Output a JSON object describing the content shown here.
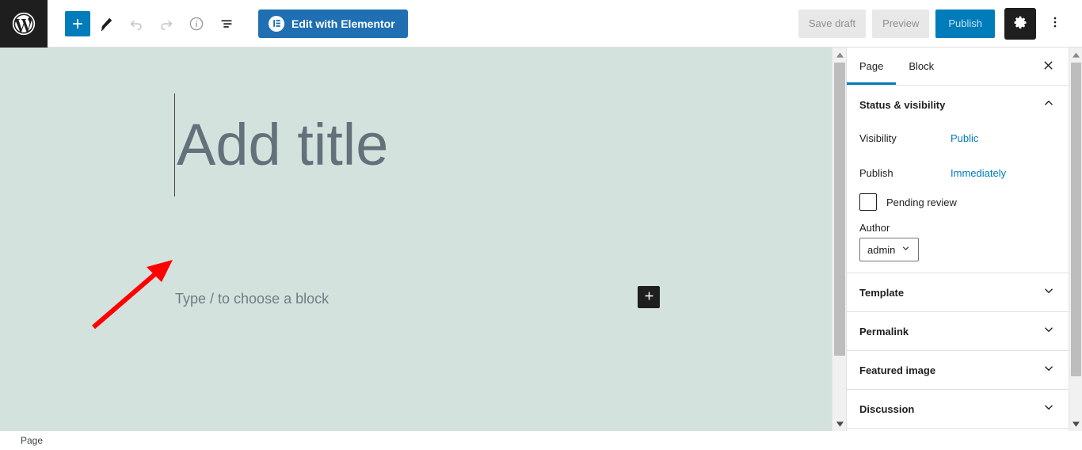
{
  "toolbar": {
    "logo_icon": "wordpress-logo-icon",
    "left_tools": [
      {
        "name": "add-block-button",
        "icon": "plus-icon",
        "label": "Add block",
        "state": "primary"
      },
      {
        "name": "tools-button",
        "icon": "pencil-icon",
        "label": "Tools",
        "state": "normal"
      },
      {
        "name": "undo-button",
        "icon": "undo-arrow-icon",
        "label": "Undo",
        "state": "disabled"
      },
      {
        "name": "redo-button",
        "icon": "redo-arrow-icon",
        "label": "Redo",
        "state": "disabled"
      },
      {
        "name": "details-button",
        "icon": "info-circle-icon",
        "label": "Details",
        "state": "normal"
      },
      {
        "name": "list-view-button",
        "icon": "list-view-icon",
        "label": "List view",
        "state": "normal"
      }
    ],
    "elementor_button": {
      "label": "Edit with Elementor",
      "icon": "elementor-logo-icon",
      "background": "#1f6fb2"
    },
    "save_draft_label": "Save draft",
    "preview_label": "Preview",
    "publish_label": "Publish",
    "settings_icon": "gear-icon",
    "options_icon": "vertical-ellipsis-icon"
  },
  "editor": {
    "background_color": "#d3e2dc",
    "title_placeholder": "Add title",
    "paragraph_placeholder": "Type / to choose a block",
    "inserter_icon": "plus-icon",
    "annotation": {
      "type": "arrow",
      "color": "#ff0000"
    }
  },
  "sidebar": {
    "tabs": [
      {
        "label": "Page",
        "active": true
      },
      {
        "label": "Block",
        "active": false
      }
    ],
    "close_icon": "close-icon",
    "sections": [
      {
        "title": "Status & visibility",
        "expanded": true,
        "chevron_icon": "chevron-up-icon",
        "rows": [
          {
            "label": "Visibility",
            "value": "Public"
          },
          {
            "label": "Publish",
            "value": "Immediately"
          }
        ],
        "checkbox": {
          "label": "Pending review",
          "checked": false
        },
        "author": {
          "label": "Author",
          "value": "admin",
          "chevron_icon": "chevron-down-icon"
        }
      },
      {
        "title": "Template",
        "expanded": false,
        "chevron_icon": "chevron-down-icon"
      },
      {
        "title": "Permalink",
        "expanded": false,
        "chevron_icon": "chevron-down-icon"
      },
      {
        "title": "Featured image",
        "expanded": false,
        "chevron_icon": "chevron-down-icon"
      },
      {
        "title": "Discussion",
        "expanded": false,
        "chevron_icon": "chevron-down-icon"
      }
    ]
  },
  "scrollbars": {
    "main_up_icon": "scroll-up-arrow-icon",
    "main_down_icon": "scroll-down-arrow-icon",
    "sidebar_up_icon": "scroll-up-arrow-icon",
    "sidebar_down_icon": "scroll-down-arrow-icon"
  },
  "status_bar": {
    "label": "Page"
  },
  "colors": {
    "accent_blue": "#007cba",
    "elementor_blue": "#1f6fb2",
    "dark": "#1e1e1e",
    "canvas": "#d3e2dc",
    "annotation_red": "#ff0000"
  }
}
